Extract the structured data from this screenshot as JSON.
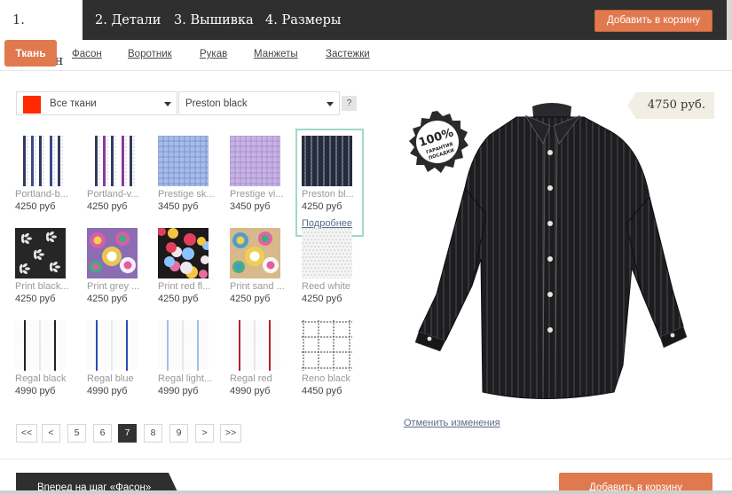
{
  "steps": [
    "1. Дизайн",
    "2. Детали",
    "3. Вышивка",
    "4. Размеры"
  ],
  "add_to_cart": "Добавить в корзину",
  "subtabs": {
    "active": "Ткань",
    "items": [
      "Фасон",
      "Воротник",
      "Рукав",
      "Манжеты",
      "Застежки"
    ]
  },
  "filters": {
    "color": "#ff2a00",
    "category": "Все ткани",
    "fabric": "Preston black",
    "help": "?"
  },
  "fabrics": [
    {
      "name": "Portland-b...",
      "price": "4250 руб",
      "pattern": "stripes",
      "bg": "#ffffff",
      "fg": "#3a4a8a"
    },
    {
      "name": "Portland-v...",
      "price": "4250 руб",
      "pattern": "stripes",
      "bg": "#ffffff",
      "fg": "#8a3a9a"
    },
    {
      "name": "Prestige sk...",
      "price": "3450 руб",
      "pattern": "check",
      "bg": "#a9bce6",
      "fg": "#7d95d4"
    },
    {
      "name": "Prestige vi...",
      "price": "3450 руб",
      "pattern": "check",
      "bg": "#c7b4e2",
      "fg": "#a88fd0"
    },
    {
      "name": "Preston bl...",
      "price": "4250 руб",
      "pattern": "darkstripe",
      "bg": "#222a3a",
      "fg": "#c8c8d8"
    },
    {
      "name": "Print black...",
      "price": "4250 руб",
      "pattern": "floral",
      "bg": "#262626",
      "fg": "#e8e8e8"
    },
    {
      "name": "Print grey ...",
      "price": "4250 руб",
      "pattern": "paisley",
      "bg": "#8c6db3",
      "fg": "#e35aa6"
    },
    {
      "name": "Print red fl...",
      "price": "4250 руб",
      "pattern": "flowers",
      "bg": "#1e1a1a",
      "fg": "#e0405a"
    },
    {
      "name": "Print sand ...",
      "price": "4250 руб",
      "pattern": "paisley",
      "bg": "#d7b98c",
      "fg": "#3e9bd1"
    },
    {
      "name": "Reed white",
      "price": "4250 руб",
      "pattern": "weave",
      "bg": "#f4f4f4",
      "fg": "#dddddd"
    },
    {
      "name": "Regal black",
      "price": "4990 руб",
      "pattern": "wide",
      "bg": "#ffffff",
      "fg": "#222222"
    },
    {
      "name": "Regal blue",
      "price": "4990 руб",
      "pattern": "wide",
      "bg": "#ffffff",
      "fg": "#2a4db0"
    },
    {
      "name": "Regal light...",
      "price": "4990 руб",
      "pattern": "wide",
      "bg": "#ffffff",
      "fg": "#9fc0e8"
    },
    {
      "name": "Regal red",
      "price": "4990 руб",
      "pattern": "wide",
      "bg": "#ffffff",
      "fg": "#b0202a"
    },
    {
      "name": "Reno black",
      "price": "4450 руб",
      "pattern": "bigcheck",
      "bg": "#ffffff",
      "fg": "#333333"
    }
  ],
  "more_link": "Подробнее",
  "pagination": [
    "<<",
    "<",
    "5",
    "6",
    "7",
    "8",
    "9",
    ">",
    ">>"
  ],
  "current_page": "7",
  "price": "4750 руб.",
  "badge": {
    "top": "100%",
    "line1": "ГАРАНТИЯ",
    "line2": "ПОСАДКИ"
  },
  "cancel_changes": "Отменить изменения",
  "next_step": "Вперед на шаг «Фасон»",
  "add_to_cart_bottom": "Добавить в корзину"
}
